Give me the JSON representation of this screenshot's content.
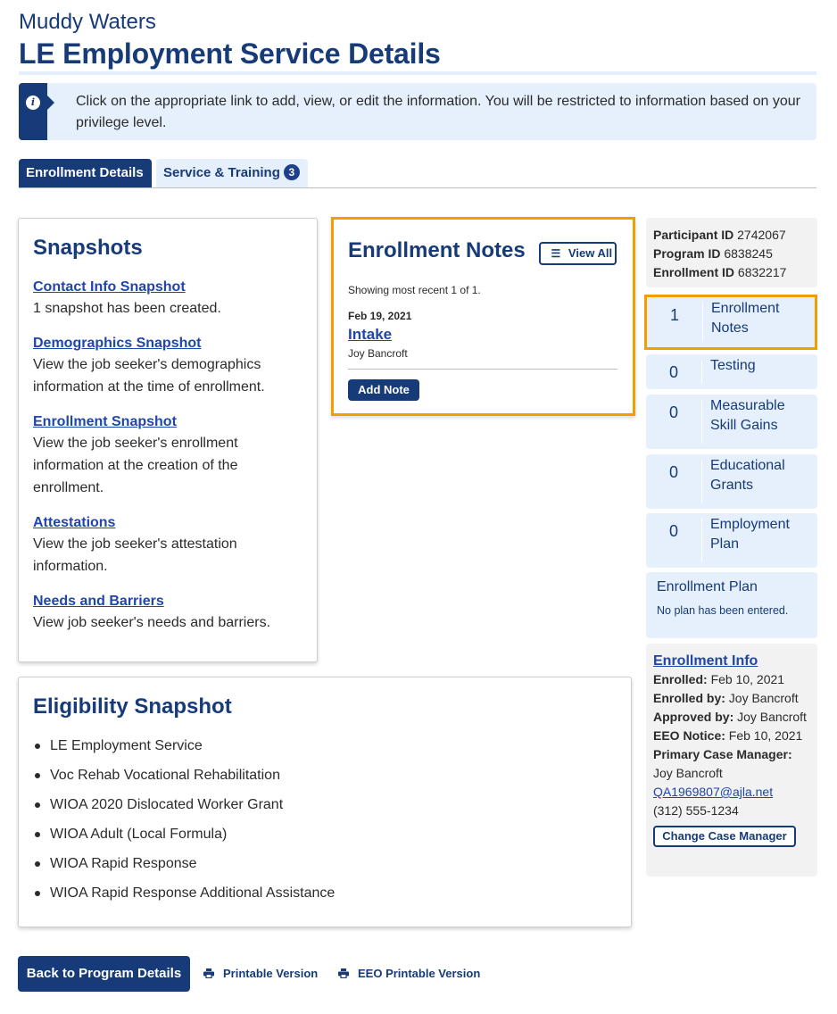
{
  "header": {
    "org_name": "Muddy Waters",
    "title": "LE Employment Service Details"
  },
  "alert": {
    "icon": "info-icon",
    "text": "Click on the appropriate link to add, view, or edit the information. You will be restricted to information based on your privilege level."
  },
  "tabs": [
    {
      "label": "Enrollment Details",
      "active": true
    },
    {
      "label": "Service & Training",
      "badge": "3",
      "active": false
    }
  ],
  "snapshots": {
    "title": "Snapshots",
    "items": [
      {
        "link": "Contact Info Snapshot",
        "desc": "1 snapshot has been created."
      },
      {
        "link": "Demographics Snapshot",
        "desc": "View the job seeker's demographics information at the time of enrollment."
      },
      {
        "link": "Enrollment Snapshot",
        "desc": "View the job seeker's enrollment information at the creation of the enrollment."
      },
      {
        "link": "Attestations",
        "desc": "View the job seeker's attestation information."
      },
      {
        "link": "Needs and Barriers",
        "desc": "View job seeker's needs and barriers."
      }
    ]
  },
  "notes": {
    "title": "Enrollment Notes",
    "view_all": "View All",
    "showing": "Showing most recent 1 of 1.",
    "items": [
      {
        "date": "Feb 19, 2021",
        "title": "Intake",
        "author": "Joy Bancroft"
      }
    ],
    "add_note": "Add Note"
  },
  "eligibility": {
    "title": "Eligibility Snapshot",
    "items": [
      "LE Employment Service",
      "Voc Rehab Vocational Rehabilitation",
      "WIOA 2020 Dislocated Worker Grant",
      "WIOA Adult (Local Formula)",
      "WIOA Rapid Response",
      "WIOA Rapid Response Additional Assistance"
    ]
  },
  "ids": {
    "participant_label": "Participant ID",
    "participant_value": "2742067",
    "program_label": "Program ID",
    "program_value": "6838245",
    "enrollment_label": "Enrollment ID",
    "enrollment_value": "6832217"
  },
  "counts": [
    {
      "count": "1",
      "label": "Enrollment Notes",
      "highlighted": true
    },
    {
      "count": "0",
      "label": "Testing"
    },
    {
      "count": "0",
      "label": "Measurable Skill Gains"
    },
    {
      "count": "0",
      "label": "Educational Grants"
    },
    {
      "count": "0",
      "label": "Employment Plan"
    }
  ],
  "plan": {
    "title": "Enrollment Plan",
    "text": "No plan has been entered."
  },
  "info": {
    "title": "Enrollment Info",
    "enrolled_label": "Enrolled:",
    "enrolled_value": "Feb 10, 2021",
    "enrolled_by_label": "Enrolled by:",
    "enrolled_by_value": "Joy Bancroft",
    "approved_by_label": "Approved by:",
    "approved_by_value": "Joy Bancroft",
    "eeo_label": "EEO Notice:",
    "eeo_value": "Feb 10, 2021",
    "pcm_label": "Primary Case Manager:",
    "pcm_name": "Joy Bancroft",
    "pcm_email": "QA1969807@ajla.net",
    "pcm_phone": "(312) 555-1234",
    "change_button": "Change Case Manager"
  },
  "footer": {
    "back_button": "Back to Program Details",
    "printable": "Printable Version",
    "eeo_printable": "EEO Printable Version"
  },
  "colors": {
    "primary": "#163b78",
    "link": "#1f46a8",
    "highlight": "#f59c00",
    "light_blue": "#e6f0fc",
    "light_gray": "#f2f2f2"
  }
}
